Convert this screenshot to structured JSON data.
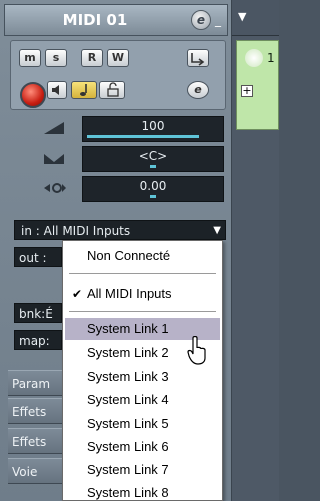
{
  "strip": {
    "title": "MIDI 01",
    "edit_icon": "e",
    "buttons": {
      "mute": "m",
      "solo": "s",
      "read": "R",
      "write": "W",
      "edit": "e"
    },
    "volume": {
      "value": "100",
      "level": 0.85
    },
    "pan": {
      "value": "<C>",
      "level": 0.5
    },
    "transpose": {
      "value": "0.00",
      "level": 0.0
    },
    "input": {
      "label": "in :",
      "value": "All MIDI Inputs"
    },
    "output_label": "out :",
    "bank_label": "bnk:",
    "bank_value": "É",
    "map_label": "map:",
    "sections": [
      "Param",
      "Effets",
      "Effets",
      "Voie"
    ]
  },
  "right": {
    "track_number": "1"
  },
  "menu": {
    "items": [
      {
        "label": "Non Connecté",
        "checked": false
      },
      {
        "label": "All MIDI Inputs",
        "checked": true
      },
      {
        "label": "System Link 1",
        "highlighted": true
      },
      {
        "label": "System Link 2"
      },
      {
        "label": "System Link 3"
      },
      {
        "label": "System Link 4"
      },
      {
        "label": "System Link 5"
      },
      {
        "label": "System Link 6"
      },
      {
        "label": "System Link 7"
      },
      {
        "label": "System Link 8"
      }
    ]
  }
}
